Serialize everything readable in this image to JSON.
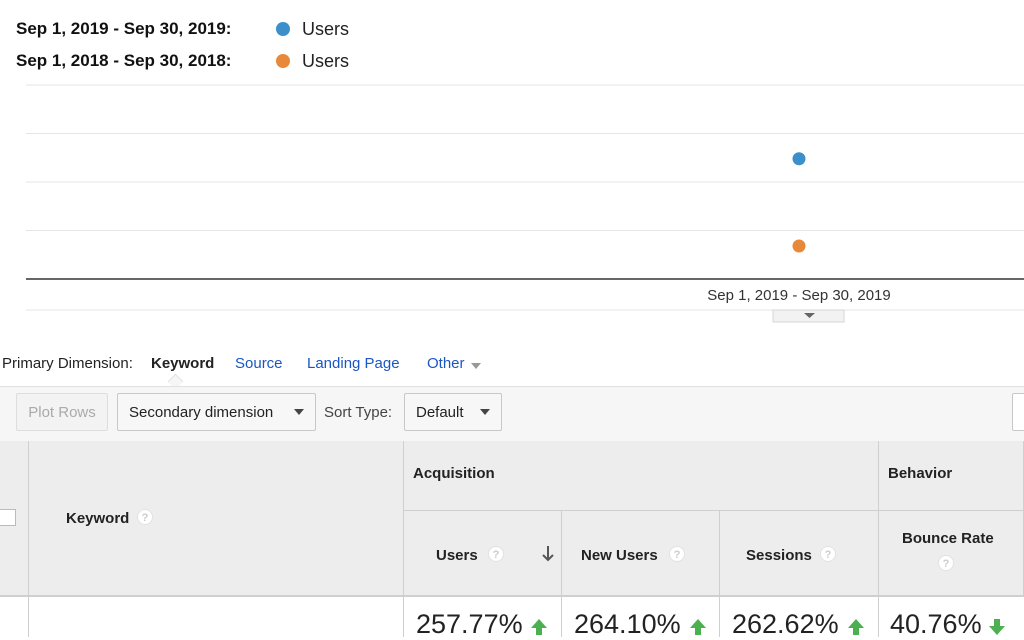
{
  "legend": [
    {
      "range": "Sep 1, 2019 - Sep 30, 2019:",
      "series": "Users",
      "color": "#3c8fcb"
    },
    {
      "range": "Sep 1, 2018 - Sep 30, 2018:",
      "series": "Users",
      "color": "#e8893a"
    }
  ],
  "chart_data": {
    "type": "scatter",
    "x": [
      "Sep 1, 2019 - Sep 30, 2019"
    ],
    "series": [
      {
        "name": "Users",
        "color": "#3c8fcb",
        "level": 0.62
      },
      {
        "name": "Users",
        "color": "#e8893a",
        "level": 0.17
      }
    ],
    "grid": true
  },
  "primary_dimension": {
    "label": "Primary Dimension:",
    "active": "Keyword",
    "links": [
      "Source",
      "Landing Page",
      "Other"
    ]
  },
  "toolbar": {
    "plot_rows": "Plot Rows",
    "secondary_dimension": "Secondary dimension",
    "sort_type_label": "Sort Type:",
    "sort_type_value": "Default"
  },
  "table": {
    "keyword_header": "Keyword",
    "groups": {
      "acquisition": "Acquisition",
      "behavior": "Behavior"
    },
    "columns": [
      "Users",
      "New Users",
      "Sessions",
      "Bounce Rate"
    ],
    "help_glyph": "?",
    "totals": [
      "257.77%",
      "264.10%",
      "262.62%",
      "40.76%"
    ],
    "trends": [
      "up",
      "up",
      "up",
      "down"
    ],
    "trend_colors": {
      "up": "#4caf50",
      "down": "#4caf50"
    }
  }
}
